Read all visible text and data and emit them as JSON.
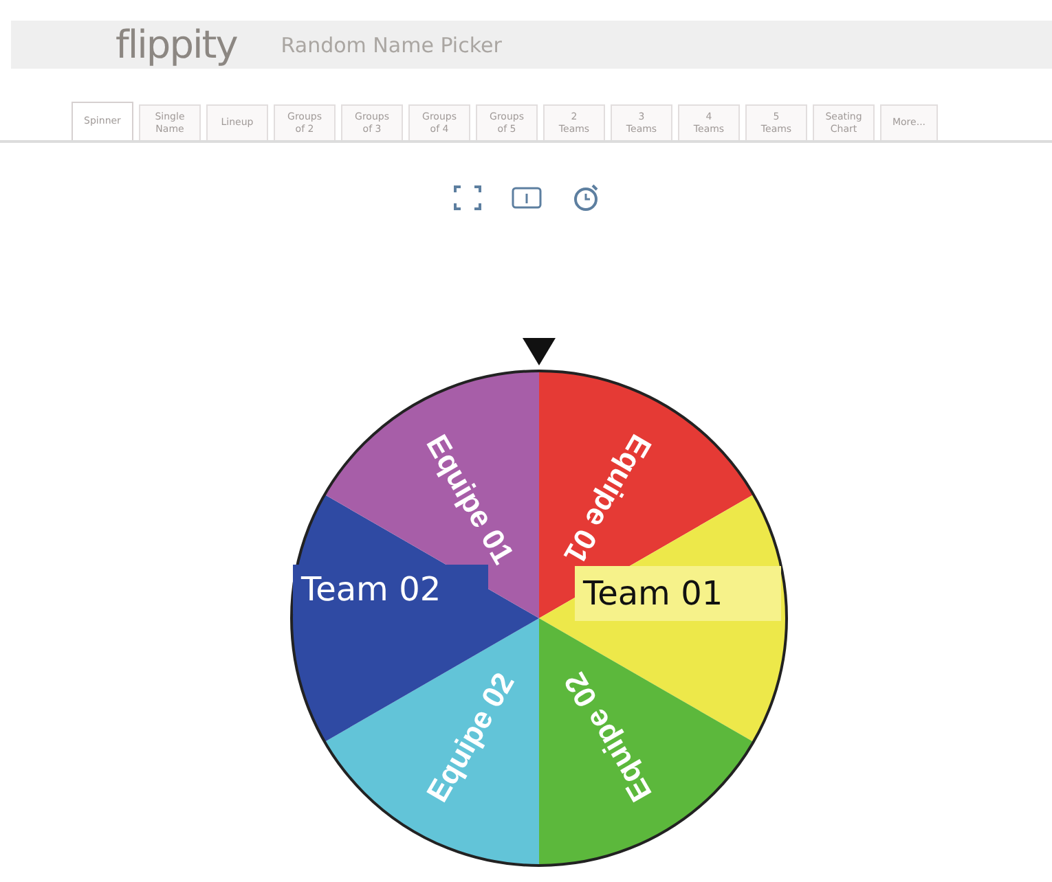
{
  "header": {
    "logo": "flippity",
    "title": "Random Name Picker"
  },
  "tabs": [
    {
      "label": "Spinner",
      "selected": true
    },
    {
      "label": "Single\nName",
      "selected": false
    },
    {
      "label": "Lineup",
      "selected": false
    },
    {
      "label": "Groups\nof 2",
      "selected": false
    },
    {
      "label": "Groups\nof 3",
      "selected": false
    },
    {
      "label": "Groups\nof 4",
      "selected": false
    },
    {
      "label": "Groups\nof 5",
      "selected": false
    },
    {
      "label": "2\nTeams",
      "selected": false
    },
    {
      "label": "3\nTeams",
      "selected": false
    },
    {
      "label": "4\nTeams",
      "selected": false
    },
    {
      "label": "5\nTeams",
      "selected": false
    },
    {
      "label": "Seating\nChart",
      "selected": false
    },
    {
      "label": "More...",
      "selected": false
    }
  ],
  "wheel": {
    "slices": [
      {
        "label": "Equipe 01",
        "color": "#e53a35"
      },
      {
        "color": "#ede84a"
      },
      {
        "label": "Equipe 02",
        "color": "#5cb83c"
      },
      {
        "label": "Equipe 02",
        "color": "#62c4d8"
      },
      {
        "color": "#2f4aa3"
      },
      {
        "label": "Equipe 01",
        "color": "#a75ea8"
      }
    ],
    "results": [
      {
        "label": "Team 02",
        "color": "#2f4aa3"
      },
      {
        "label": "Team 01",
        "color": "#f6f28a"
      }
    ]
  }
}
